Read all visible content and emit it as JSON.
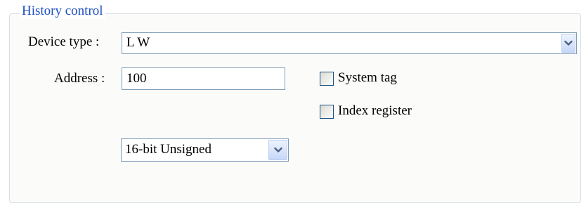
{
  "group": {
    "title": "History control"
  },
  "device_type": {
    "label": "Device type :",
    "value": "L W",
    "icon": "chevron-down-icon"
  },
  "address": {
    "label": "Address :",
    "value": "100"
  },
  "system_tag": {
    "label": "System tag",
    "checked": false
  },
  "index_register": {
    "label": "Index register",
    "checked": false
  },
  "data_format": {
    "value": "16-bit Unsigned",
    "icon": "chevron-down-icon"
  },
  "colors": {
    "group_title": "#1b4fbf",
    "field_border": "#7f9db9",
    "checkbox_border": "#1c5180",
    "dropdown_arrow": "#4d6185"
  }
}
